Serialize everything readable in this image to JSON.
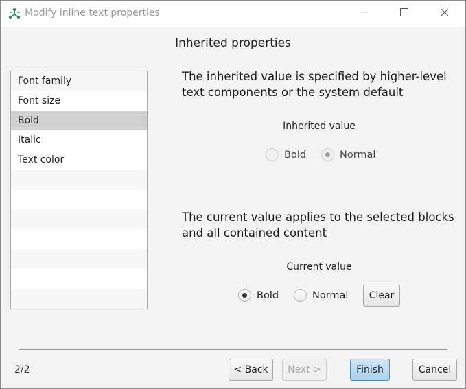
{
  "window": {
    "title": "Modify inline text properties"
  },
  "header": {
    "title": "Inherited properties"
  },
  "property_list": {
    "items": [
      {
        "label": "Font family",
        "selected": false
      },
      {
        "label": "Font size",
        "selected": false
      },
      {
        "label": "Bold",
        "selected": true
      },
      {
        "label": "Italic",
        "selected": false
      },
      {
        "label": "Text color",
        "selected": false
      }
    ]
  },
  "inherited": {
    "description": "The inherited value is specified by higher-level text components or the system default",
    "group_label": "Inherited value",
    "options": [
      {
        "label": "Bold",
        "checked": false
      },
      {
        "label": "Normal",
        "checked": true
      }
    ]
  },
  "current": {
    "description": "The current value applies to the selected blocks and all contained content",
    "group_label": "Current value",
    "options": [
      {
        "label": "Bold",
        "checked": true
      },
      {
        "label": "Normal",
        "checked": false
      }
    ],
    "clear_label": "Clear"
  },
  "footer": {
    "page_count": "2/2",
    "back_label": "< Back",
    "next_label": "Next >",
    "finish_label": "Finish",
    "cancel_label": "Cancel"
  },
  "colors": {
    "accent": "#2e8b57",
    "selected_row": "#d0d0d0",
    "primary_button": "#a9d1ef"
  }
}
